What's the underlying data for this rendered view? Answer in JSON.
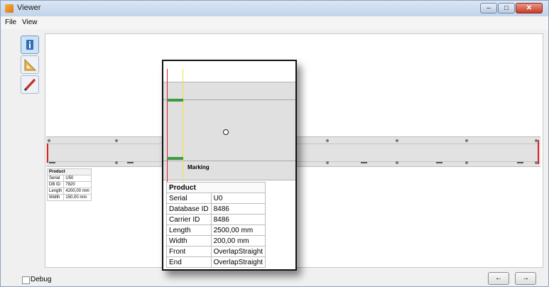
{
  "window": {
    "title": "Viewer",
    "controls": {
      "minimize": "–",
      "maximize": "□",
      "close": "✕"
    }
  },
  "menu": {
    "items": [
      "File",
      "View"
    ]
  },
  "toolbar": {
    "tools": [
      {
        "name": "info-tool",
        "icon": "info-icon",
        "active": true
      },
      {
        "name": "measure-tool",
        "icon": "ruler-triangle-icon",
        "active": false
      },
      {
        "name": "draw-tool",
        "icon": "pencil-icon",
        "active": false
      }
    ]
  },
  "canvas": {
    "small_product_table": {
      "header": "Product",
      "rows": [
        [
          "Serial",
          "U50"
        ],
        [
          "DB ID",
          "7820"
        ],
        [
          "Length",
          "4200,00 mm"
        ],
        [
          "Width",
          "150,00 mm"
        ]
      ]
    }
  },
  "popup": {
    "marking_label": "Marking",
    "table": {
      "header": "Product",
      "rows": [
        [
          "Serial",
          "U0"
        ],
        [
          "Database ID",
          "8486"
        ],
        [
          "Carrier ID",
          "8486"
        ],
        [
          "Length",
          "2500,00 mm"
        ],
        [
          "Width",
          "200,00 mm"
        ],
        [
          "Front",
          "OverlapStraight"
        ],
        [
          "End",
          "OverlapStraight"
        ]
      ]
    }
  },
  "statusbar": {
    "debug_label": "Debug",
    "debug_checked": false,
    "prev_label": "←",
    "next_label": "→"
  },
  "colors": {
    "accent_red": "#e02020",
    "marker_green": "#3f9a3f",
    "guide_yellow": "#e6e63a",
    "strip_gray": "#e2e2e2"
  }
}
